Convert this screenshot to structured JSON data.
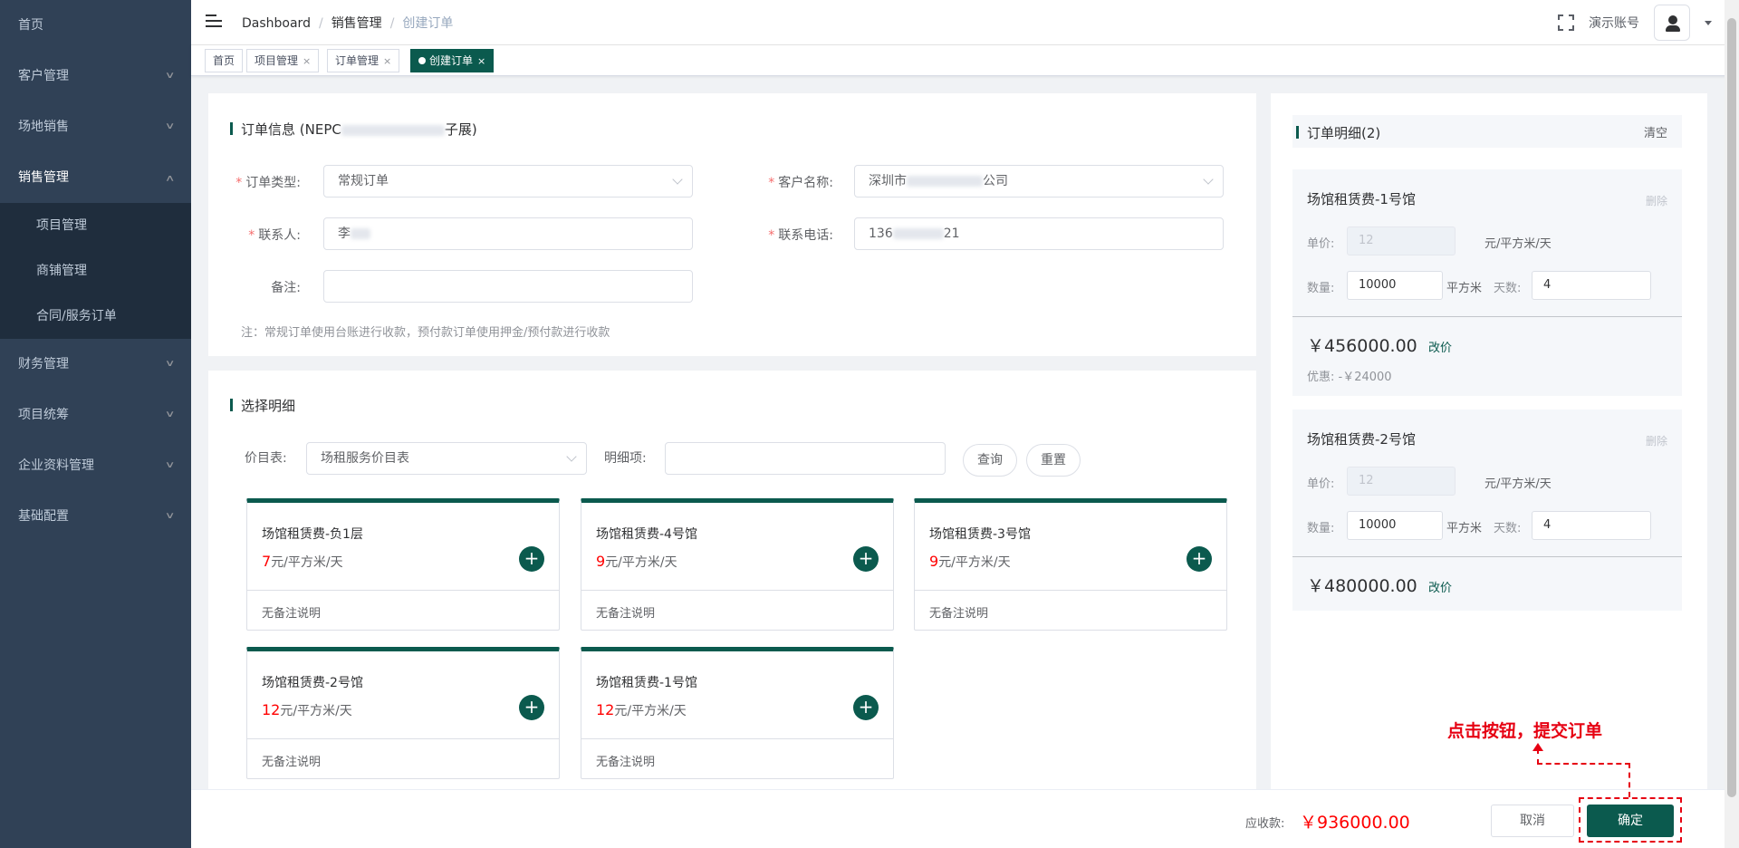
{
  "sidebar": {
    "home": "首页",
    "items": [
      {
        "label": "客户管理"
      },
      {
        "label": "场地销售"
      },
      {
        "label": "销售管理"
      },
      {
        "label": "财务管理"
      },
      {
        "label": "项目统筹"
      },
      {
        "label": "企业资料管理"
      },
      {
        "label": "基础配置"
      }
    ],
    "sub_items": [
      {
        "label": "项目管理"
      },
      {
        "label": "商铺管理"
      },
      {
        "label": "合同/服务订单"
      }
    ]
  },
  "header": {
    "breadcrumb": [
      "Dashboard",
      "销售管理",
      "创建订单"
    ],
    "account": "演示账号"
  },
  "tags": [
    {
      "label": "首页"
    },
    {
      "label": "项目管理"
    },
    {
      "label": "订单管理"
    },
    {
      "label": "创建订单"
    }
  ],
  "order_info": {
    "title_prefix": "订单信息 (NEPC",
    "title_suffix": "子展)",
    "order_type_label": "订单类型:",
    "order_type_value": "常规订单",
    "customer_label": "客户名称:",
    "customer_prefix": "深圳市",
    "customer_suffix": "公司",
    "contact_label": "联系人:",
    "contact_value": "李",
    "phone_label": "联系电话:",
    "phone_prefix": "136",
    "phone_suffix": "21",
    "remark_label": "备注:",
    "note": "注：常规订单使用台账进行收款，预付款订单使用押金/预付款进行收款"
  },
  "select": {
    "title": "选择明细",
    "price_list_label": "价目表:",
    "price_list_value": "场租服务价目表",
    "item_label": "明细项:",
    "query_button": "查询",
    "reset_button": "重置",
    "cards": [
      {
        "name": "场馆租赁费-负1层",
        "price": "7",
        "unit": "元/平方米/天",
        "note": "无备注说明"
      },
      {
        "name": "场馆租赁费-4号馆",
        "price": "9",
        "unit": "元/平方米/天",
        "note": "无备注说明"
      },
      {
        "name": "场馆租赁费-3号馆",
        "price": "9",
        "unit": "元/平方米/天",
        "note": "无备注说明"
      },
      {
        "name": "场馆租赁费-2号馆",
        "price": "12",
        "unit": "元/平方米/天",
        "note": "无备注说明"
      },
      {
        "name": "场馆租赁费-1号馆",
        "price": "12",
        "unit": "元/平方米/天",
        "note": "无备注说明"
      }
    ]
  },
  "detail": {
    "title": "订单明细(2)",
    "clear": "清空",
    "delete": "删除",
    "unit_price_label": "单价:",
    "qty_label": "数量:",
    "days_label": "天数:",
    "price_unit": "元/平方米/天",
    "qty_unit": "平方米",
    "edit_price": "改价",
    "items": [
      {
        "name": "场馆租赁费-1号馆",
        "unit_price": "12",
        "qty": "10000",
        "days": "4",
        "total": "￥456000.00",
        "discount": "优惠: -￥24000"
      },
      {
        "name": "场馆租赁费-2号馆",
        "unit_price": "12",
        "qty": "10000",
        "days": "4",
        "total": "￥480000.00"
      }
    ]
  },
  "footer": {
    "receivable_label": "应收款:",
    "receivable_value": "￥936000.00",
    "cancel": "取消",
    "confirm": "确定",
    "annotation": "点击按钮，提交订单"
  },
  "colors": {
    "accent": "#0b5a4e",
    "sidebar": "#304156",
    "price_red": "#ff0000",
    "annotation_red": "#e60012"
  }
}
